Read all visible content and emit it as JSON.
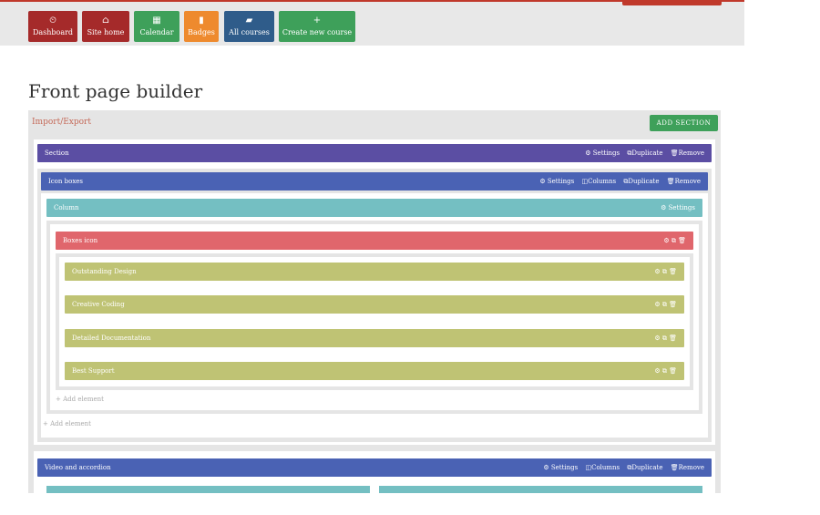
{
  "nav": {
    "buttons": [
      {
        "label": "Dashboard",
        "icon": "dashboard-icon",
        "glyph": "⏲",
        "color": "#a52a2a"
      },
      {
        "label": "Site home",
        "icon": "home-icon",
        "glyph": "⌂",
        "color": "#a52a2a"
      },
      {
        "label": "Calendar",
        "icon": "calendar-icon",
        "glyph": "▦",
        "color": "#3ea05a"
      },
      {
        "label": "Badges",
        "icon": "bookmark-icon",
        "glyph": "▮",
        "color": "#ee8a2e"
      },
      {
        "label": "All courses",
        "icon": "book-icon",
        "glyph": "▰",
        "color": "#2f5c8a"
      },
      {
        "label": "Create new course",
        "icon": "plus-icon",
        "glyph": "+",
        "color": "#3ea05a"
      }
    ]
  },
  "page": {
    "title": "Front page builder"
  },
  "builder": {
    "import_export": "Import/Export",
    "add_section": "ADD SECTION",
    "section": {
      "label": "Section",
      "settings": "⚙ Settings",
      "duplicate": "⧉Duplicate",
      "remove": "🗑Remove"
    },
    "icon_boxes": {
      "label": "Icon boxes",
      "settings": "⚙ Settings",
      "columns": "◫Columns",
      "duplicate": "⧉Duplicate",
      "remove": "🗑Remove"
    },
    "column": {
      "label": "Column",
      "settings": "⚙ Settings"
    },
    "boxes_icon": {
      "label": "Boxes icon",
      "actions": "⚙  ⧉  🗑"
    },
    "items": [
      {
        "label": "Outstanding Design",
        "actions": "⚙  ⧉  🗑"
      },
      {
        "label": "Creative Coding",
        "actions": "⚙  ⧉  🗑"
      },
      {
        "label": "Detailed Documentation",
        "actions": "⚙  ⧉  🗑"
      },
      {
        "label": "Best Support",
        "actions": "⚙  ⧉  🗑"
      }
    ],
    "add_element_inner": "+ Add element",
    "add_element_outer": "+ Add element",
    "video": {
      "label": "Video and accordion",
      "settings": "⚙ Settings",
      "columns": "◫Columns",
      "duplicate": "⧉Duplicate",
      "remove": "🗑Remove"
    }
  }
}
